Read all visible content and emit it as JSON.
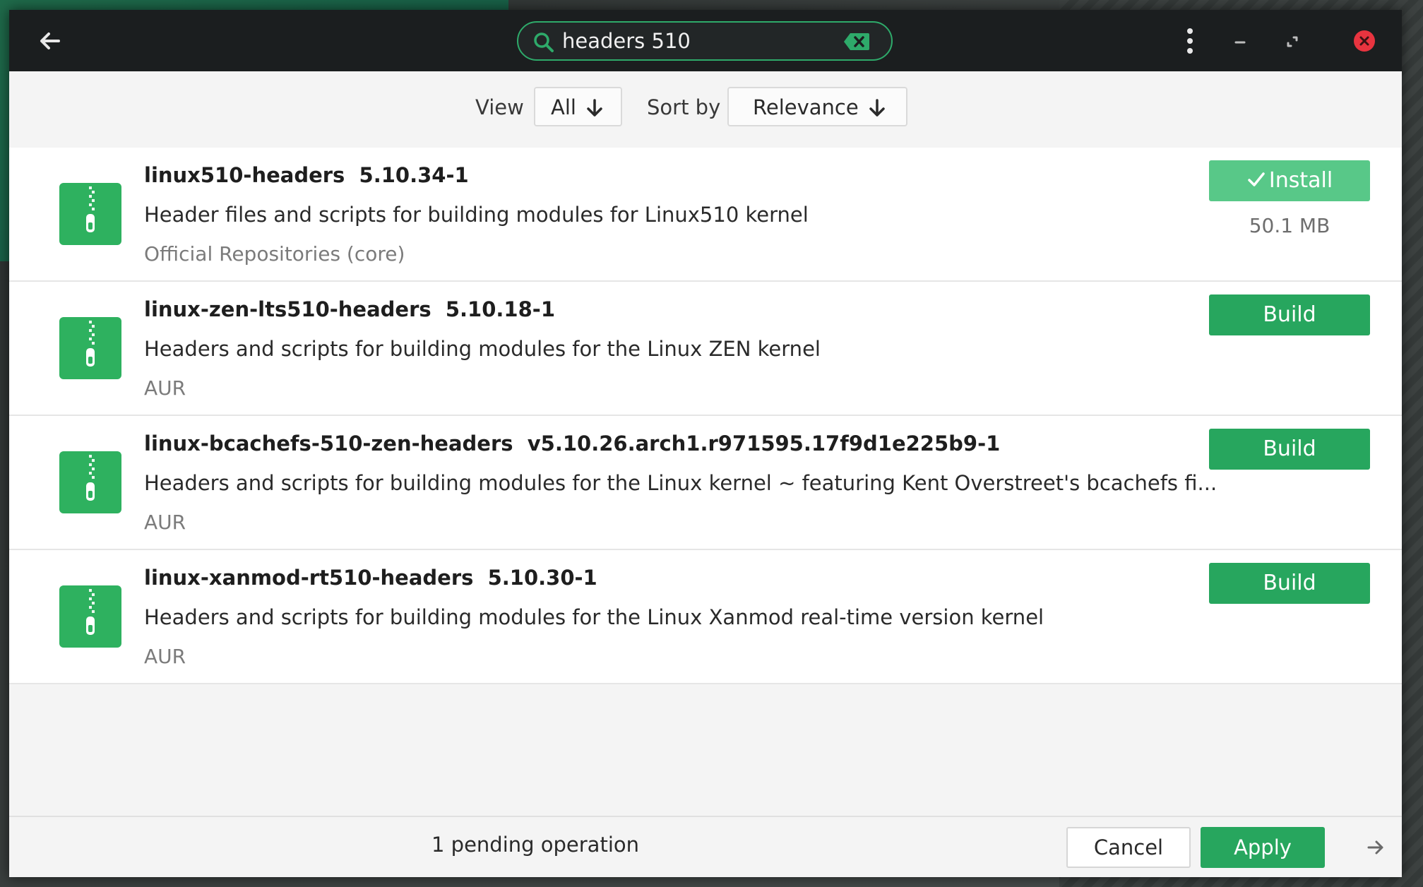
{
  "header": {
    "search_value": "headers 510",
    "icons": [
      "back-arrow-icon",
      "search-icon",
      "clear-search-icon",
      "kebab-menu-icon",
      "minimize-icon",
      "maximize-icon",
      "close-icon"
    ]
  },
  "filters": {
    "view_label": "View",
    "view_value": "All",
    "sort_label": "Sort by",
    "sort_value": "Relevance"
  },
  "packages": [
    {
      "name": "linux510-headers",
      "version": "5.10.34-1",
      "description": "Header files and scripts for building modules for Linux510 kernel",
      "repo": "Official Repositories (core)",
      "action": "Install",
      "action_checked": true,
      "size": "50.1 MB"
    },
    {
      "name": "linux-zen-lts510-headers",
      "version": "5.10.18-1",
      "description": "Headers and scripts for building modules for the Linux ZEN kernel",
      "repo": "AUR",
      "action": "Build"
    },
    {
      "name": "linux-bcachefs-510-zen-headers",
      "version": "v5.10.26.arch1.r971595.17f9d1e225b9-1",
      "description": "Headers and scripts for building modules for the Linux kernel ~ featuring Kent Overstreet's bcachefs fi...",
      "repo": "AUR",
      "action": "Build"
    },
    {
      "name": "linux-xanmod-rt510-headers",
      "version": "5.10.30-1",
      "description": "Headers and scripts for building modules for the Linux Xanmod real-time version kernel",
      "repo": "AUR",
      "action": "Build"
    }
  ],
  "footer": {
    "pending": "1 pending operation",
    "cancel_label": "Cancel",
    "apply_label": "Apply"
  },
  "colors": {
    "accent": "#27a65e",
    "accent_checked": "#58c888",
    "header_bg": "#1b1e1f",
    "close_red": "#e8343f"
  }
}
